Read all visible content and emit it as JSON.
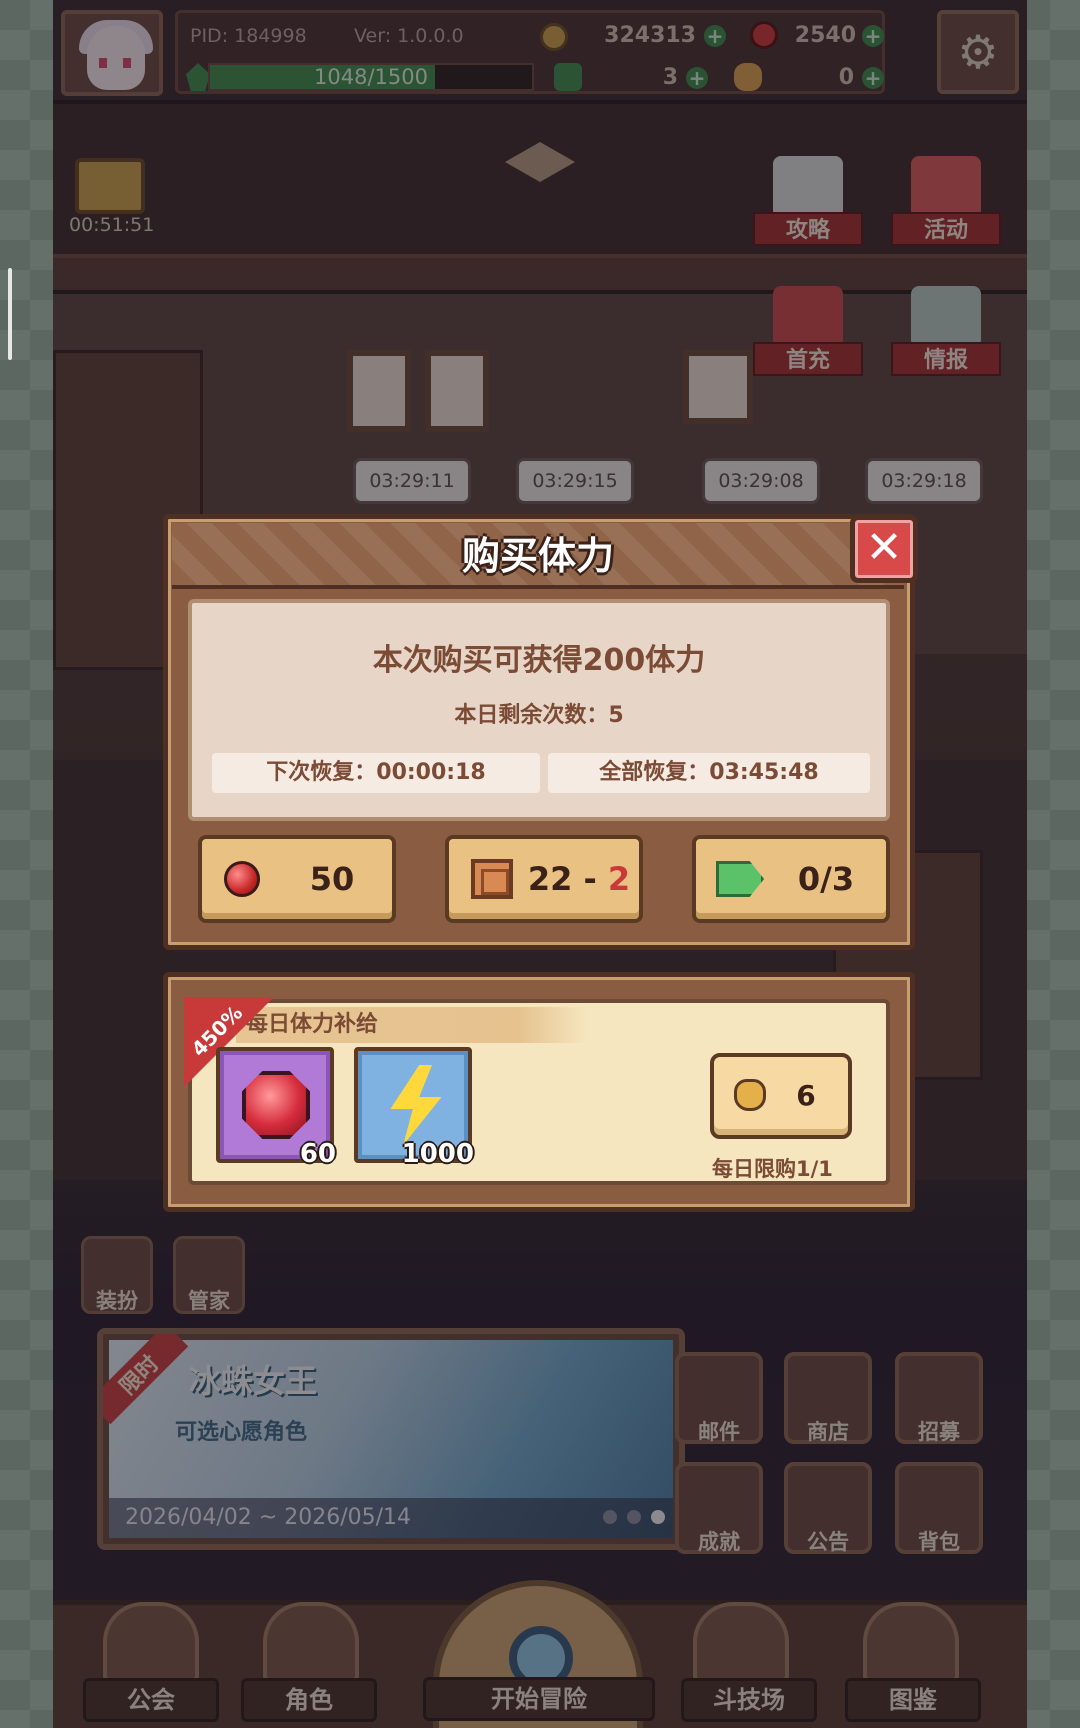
{
  "topbar": {
    "pid": "PID: 184998",
    "version": "Ver: 1.0.0.0",
    "gold": "324313",
    "gems": "2540",
    "stamina": "1048/1500",
    "stamina_fraction": 0.699,
    "clover": "3",
    "bag_currency": "0"
  },
  "lobby": {
    "gift_timer": "00:51:51",
    "guide_label": "攻略",
    "event_label": "活动",
    "first_recharge_label": "首充",
    "intel_label": "情报",
    "timers": [
      "03:29:11",
      "03:29:15",
      "03:29:08",
      "03:29:18"
    ],
    "dress_label": "装扮",
    "butler_label": "管家",
    "banner": {
      "badge": "限时",
      "name": "冰蛛女王",
      "subtitle": "可选心愿角色",
      "dates": "2026/04/02 ~ 2026/05/14"
    },
    "grid": [
      "邮件",
      "商店",
      "招募",
      "成就",
      "公告",
      "背包"
    ],
    "nav": {
      "guild": "公会",
      "character": "角色",
      "adventure": "开始冒险",
      "arena": "斗技场",
      "codex": "图鉴"
    }
  },
  "dialog": {
    "title": "购买体力",
    "gain_text": "本次购买可获得200体力",
    "remaining_text": "本日剩余次数：5",
    "next_recover": "下次恢复：00:00:18",
    "full_recover": "全部恢复：03:45:48",
    "cost_gem": "50",
    "cost_ticket_owned": "22",
    "cost_ticket_sep": " - ",
    "cost_ticket_need": "2",
    "cost_tag": "0/3"
  },
  "supply": {
    "percent": "450%",
    "title": "每日体力补给",
    "item1_qty": "60",
    "item2_qty": "1000",
    "price": "6",
    "limit": "每日限购1/1"
  },
  "colors": {
    "close_red": "#d84a4a",
    "stamina_green": "#3e8a4c",
    "cost_gold": "#e8c183"
  }
}
